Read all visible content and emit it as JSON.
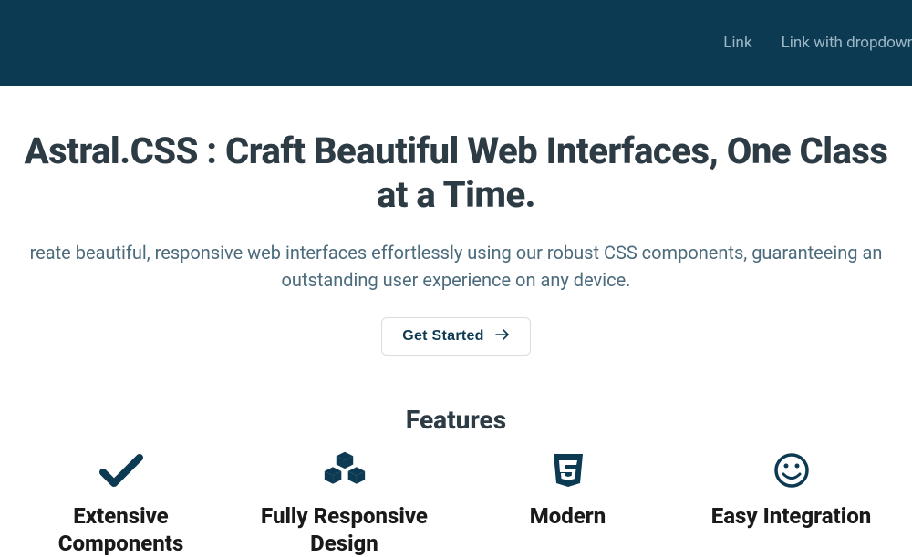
{
  "nav": {
    "links": [
      {
        "label": "Link"
      },
      {
        "label": "Link with dropdown"
      }
    ]
  },
  "hero": {
    "title": "Astral.CSS : Craft Beautiful Web Interfaces, One Class at a Time.",
    "subtitle": "reate beautiful, responsive web interfaces effortlessly using our robust CSS components, guaranteeing an outstanding user experience on any device.",
    "cta_label": "Get Started"
  },
  "features": {
    "heading": "Features",
    "items": [
      {
        "title": "Extensive Components",
        "icon": "check"
      },
      {
        "title": "Fully Responsive Design",
        "icon": "cubes"
      },
      {
        "title": "Modern",
        "icon": "css3"
      },
      {
        "title": "Easy Integration",
        "icon": "smile"
      }
    ]
  }
}
